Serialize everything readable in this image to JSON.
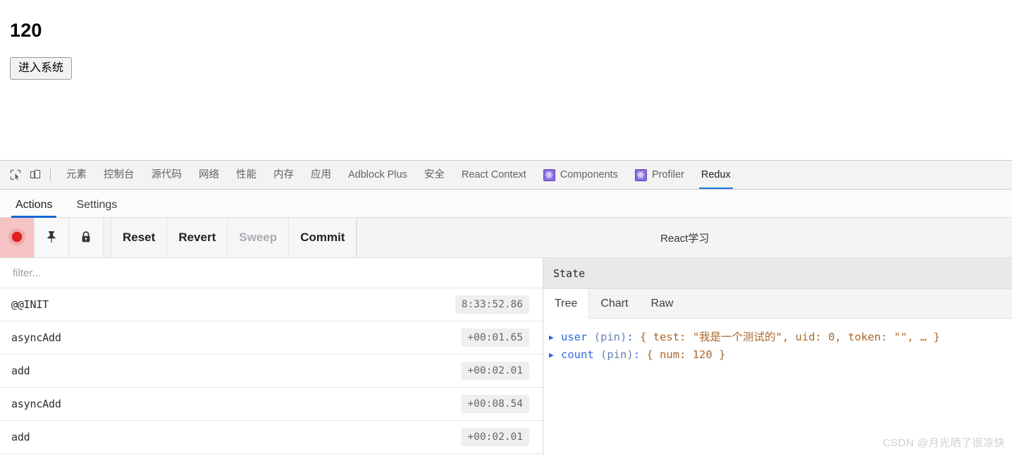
{
  "page": {
    "count_display": "120",
    "enter_button_label": "进入系统"
  },
  "devtools": {
    "icons": {
      "inspect": "inspect-element-icon",
      "device": "device-toolbar-icon"
    },
    "tabs": [
      {
        "label": "元素",
        "active": false,
        "icon": null
      },
      {
        "label": "控制台",
        "active": false,
        "icon": null
      },
      {
        "label": "源代码",
        "active": false,
        "icon": null
      },
      {
        "label": "网络",
        "active": false,
        "icon": null
      },
      {
        "label": "性能",
        "active": false,
        "icon": null
      },
      {
        "label": "内存",
        "active": false,
        "icon": null
      },
      {
        "label": "应用",
        "active": false,
        "icon": null
      },
      {
        "label": "Adblock Plus",
        "active": false,
        "icon": null
      },
      {
        "label": "安全",
        "active": false,
        "icon": null
      },
      {
        "label": "React Context",
        "active": false,
        "icon": null
      },
      {
        "label": "Components",
        "active": false,
        "icon": "react-atom-icon"
      },
      {
        "label": "Profiler",
        "active": false,
        "icon": "react-atom-icon"
      },
      {
        "label": "Redux",
        "active": true,
        "icon": null
      }
    ]
  },
  "redux": {
    "subtabs": [
      {
        "label": "Actions",
        "active": true
      },
      {
        "label": "Settings",
        "active": false
      }
    ],
    "toolbar": {
      "record_icon": "record-circle-icon",
      "pin_icon": "pin-icon",
      "lock_icon": "lock-icon",
      "reset_label": "Reset",
      "revert_label": "Revert",
      "sweep_label": "Sweep",
      "commit_label": "Commit",
      "instance_label": "React学习"
    },
    "filter": {
      "placeholder": "filter...",
      "value": ""
    },
    "actions": [
      {
        "name": "@@INIT",
        "time": "8:33:52.86"
      },
      {
        "name": "asyncAdd",
        "time": "+00:01.65"
      },
      {
        "name": "add",
        "time": "+00:02.01"
      },
      {
        "name": "asyncAdd",
        "time": "+00:08.54"
      },
      {
        "name": "add",
        "time": "+00:02.01"
      }
    ],
    "inspector": {
      "header": "State",
      "tabs": [
        {
          "label": "Tree",
          "active": true
        },
        {
          "label": "Chart",
          "active": false
        },
        {
          "label": "Raw",
          "active": false
        }
      ],
      "tree": [
        {
          "key": "user",
          "pin": "(pin)",
          "colon": ":",
          "open": "{",
          "props": "test: \"我是一个测试的\", uid: 0, token: \"\", …",
          "close": "}"
        },
        {
          "key": "count",
          "pin": "(pin)",
          "colon": ":",
          "open": "{",
          "props": "num: 120",
          "close": "}"
        }
      ]
    }
  },
  "watermark": "CSDN @月光晒了很凉快",
  "colors": {
    "accent_blue": "#1a73e8",
    "react_purple": "#8b6fe0",
    "record_red": "#e02020",
    "tree_key_blue": "#2a6be0",
    "tree_value_brown": "#a9672b"
  }
}
